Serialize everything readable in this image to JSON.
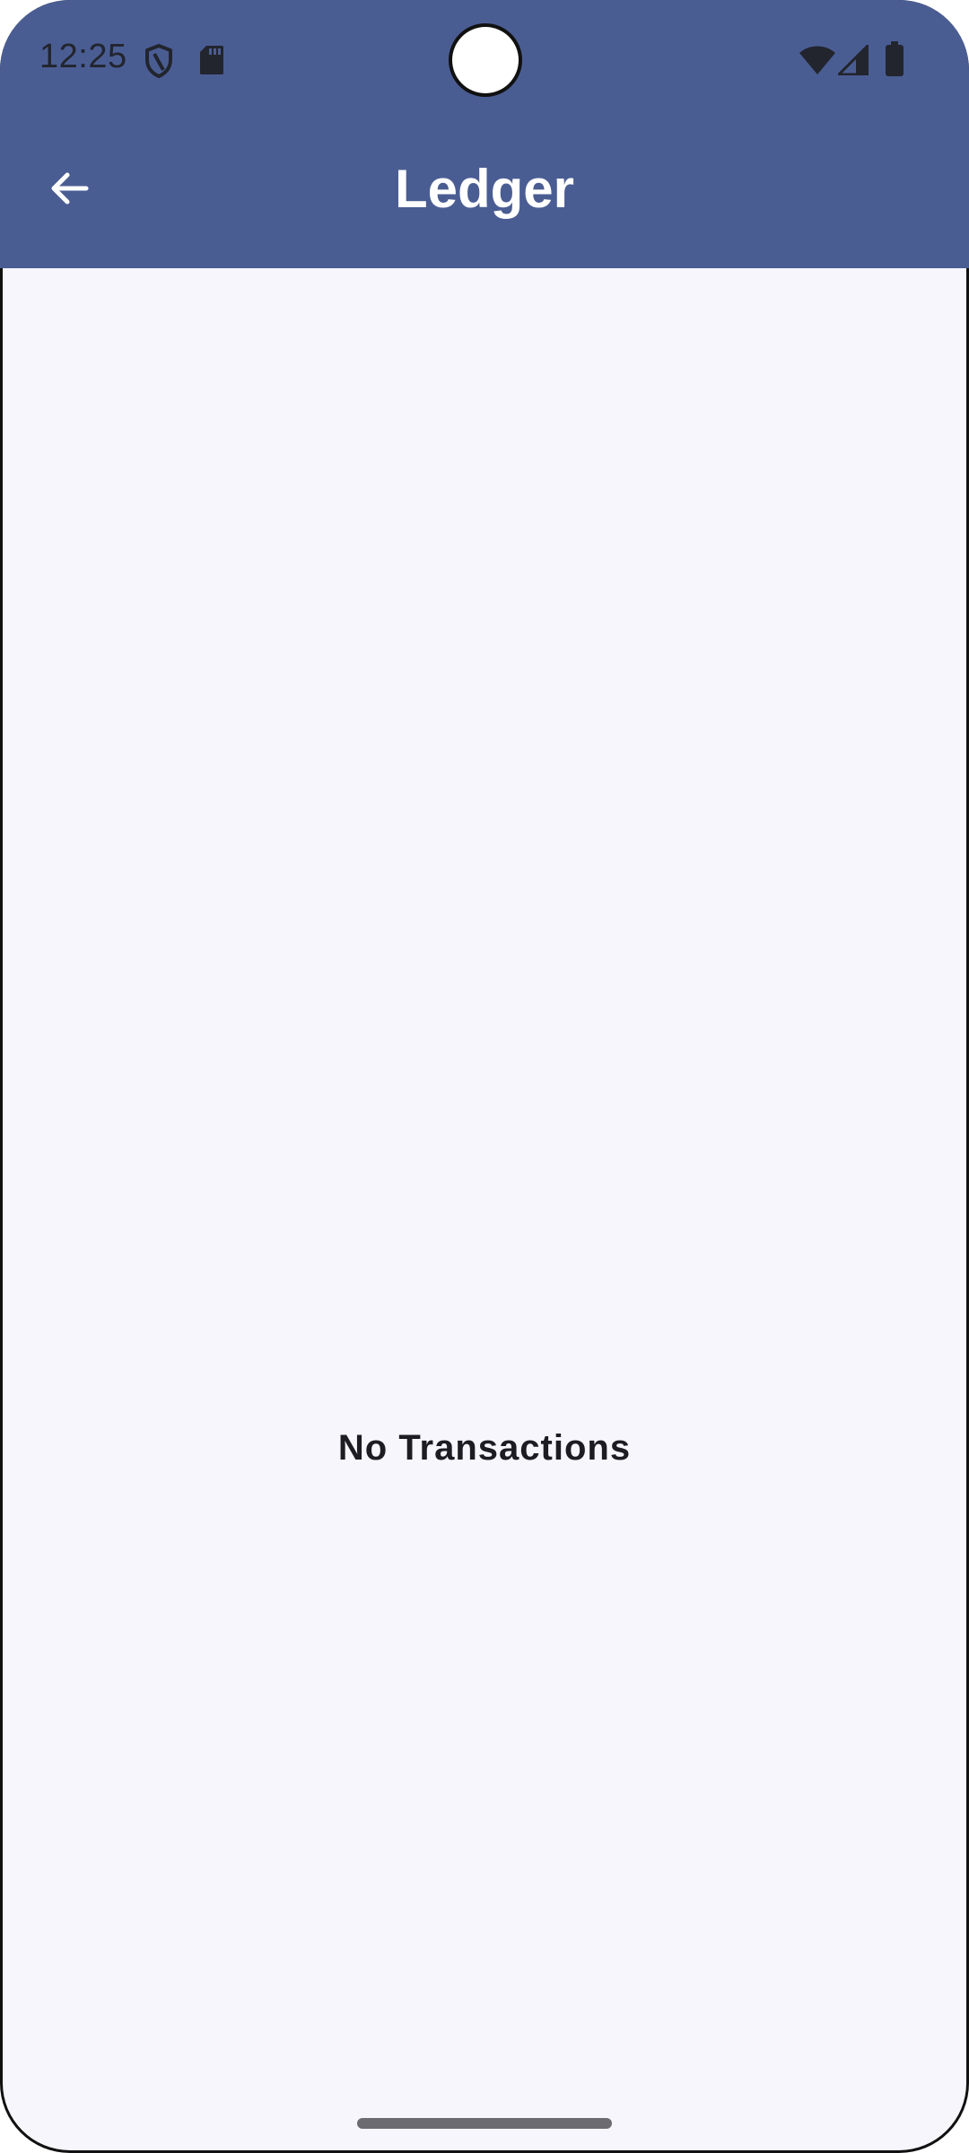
{
  "status_bar": {
    "time": "12:25",
    "left_icons": [
      "shield-icon",
      "sd-card-icon"
    ],
    "right_icons": [
      "wifi-icon",
      "cellular-signal-icon",
      "battery-icon"
    ]
  },
  "app_bar": {
    "title": "Ledger",
    "back_icon": "arrow-left-icon",
    "background_color": "#4a5d93"
  },
  "content": {
    "empty_message": "No Transactions",
    "background_color": "#f6f6fc"
  }
}
